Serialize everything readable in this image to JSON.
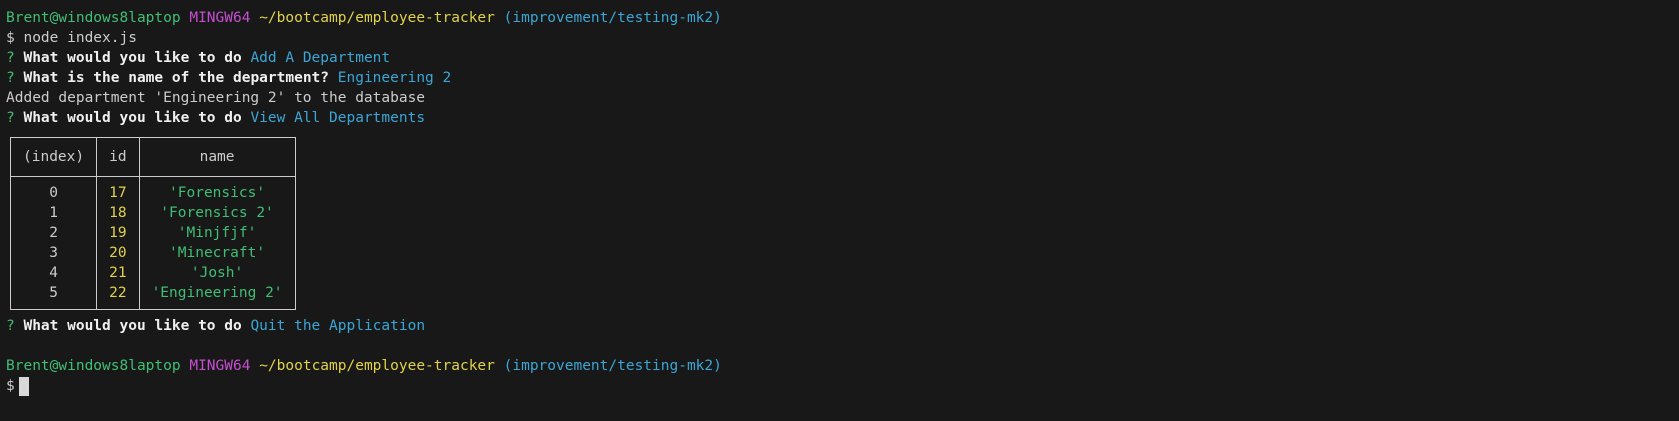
{
  "prompt_header": {
    "user_host": "Brent@windows8laptop",
    "shell": "MINGW64",
    "path": "~/bootcamp/employee-tracker",
    "branch": "(improvement/testing-mk2)"
  },
  "command": "$ node index.js",
  "q_mark": "?",
  "q1": {
    "question": "What would you like to do",
    "answer": "Add A Department"
  },
  "q2": {
    "question": "What is the name of the department?",
    "answer": "Engineering 2"
  },
  "msg": "Added department 'Engineering 2' to the database",
  "q3": {
    "question": "What would you like to do",
    "answer": "View All Departments"
  },
  "table": {
    "headers": [
      "(index)",
      "id",
      "name"
    ],
    "rows": [
      {
        "index": "0",
        "id": "17",
        "name": "'Forensics'"
      },
      {
        "index": "1",
        "id": "18",
        "name": "'Forensics 2'"
      },
      {
        "index": "2",
        "id": "19",
        "name": "'Minjfjf'"
      },
      {
        "index": "3",
        "id": "20",
        "name": "'Minecraft'"
      },
      {
        "index": "4",
        "id": "21",
        "name": "'Josh'"
      },
      {
        "index": "5",
        "id": "22",
        "name": "'Engineering 2'"
      }
    ]
  },
  "q4": {
    "question": "What would you like to do",
    "answer": "Quit the Application"
  },
  "prompt_symbol": "$"
}
